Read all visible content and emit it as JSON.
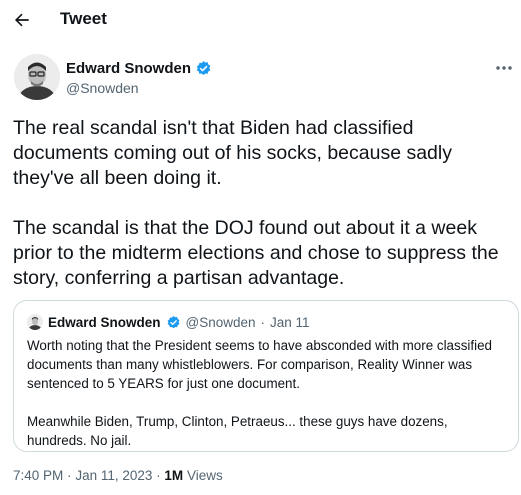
{
  "header": {
    "title": "Tweet",
    "back_icon": "arrow-left-icon"
  },
  "author": {
    "name": "Edward Snowden",
    "handle": "@Snowden",
    "verified_icon": "verified-badge-icon",
    "more_icon": "more-icon"
  },
  "tweet": {
    "paragraphs": [
      "The real scandal isn't that Biden had classified documents coming out of his socks, because sadly they've all been doing it.",
      "The scandal is that the DOJ found out about it a week prior to the midterm elections and chose to suppress the story, conferring a partisan advantage."
    ]
  },
  "quote": {
    "name": "Edward Snowden",
    "handle": "@Snowden",
    "separator": "·",
    "date": "Jan 11",
    "paragraphs": [
      "Worth noting that the President seems to have absconded with more classified documents than many whistleblowers. For comparison, Reality Winner was sentenced to 5 YEARS for just one document.",
      "Meanwhile Biden, Trump, Clinton, Petraeus... these guys have dozens, hundreds. No jail."
    ]
  },
  "meta": {
    "time": "7:40 PM",
    "separator": "·",
    "date": "Jan 11, 2023",
    "views_count": "1M",
    "views_label": "Views"
  },
  "colors": {
    "text": "#0f1419",
    "secondary": "#536471",
    "verified": "#1d9bf0",
    "border": "#cfd9de"
  }
}
